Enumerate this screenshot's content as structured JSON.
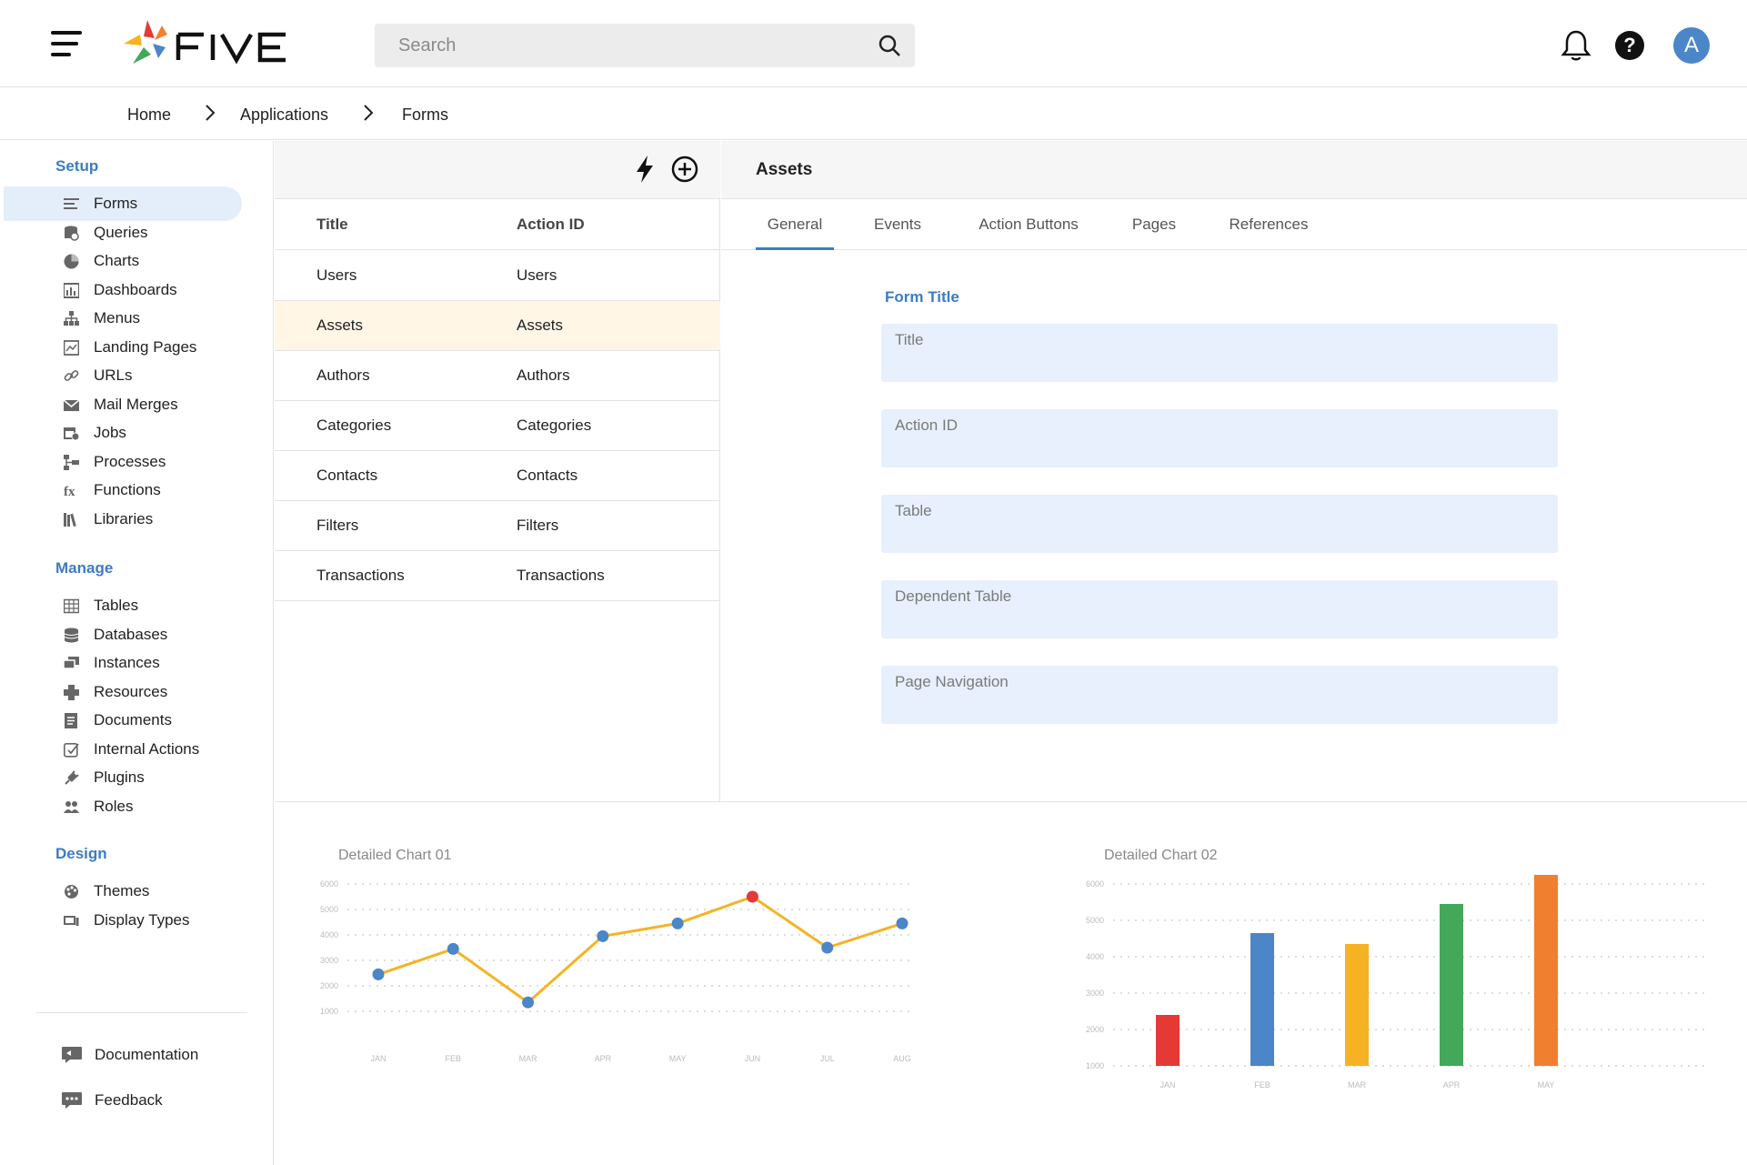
{
  "header": {
    "logo_text": "FIVE",
    "search_placeholder": "Search",
    "avatar_initial": "A",
    "help_label": "?"
  },
  "breadcrumb": [
    "Home",
    "Applications",
    "Forms"
  ],
  "sidebar": {
    "sections": [
      {
        "title": "Setup",
        "items": [
          {
            "label": "Forms",
            "icon": "forms-icon",
            "active": true
          },
          {
            "label": "Queries",
            "icon": "queries-icon"
          },
          {
            "label": "Charts",
            "icon": "charts-icon"
          },
          {
            "label": "Dashboards",
            "icon": "dashboards-icon"
          },
          {
            "label": "Menus",
            "icon": "menus-icon"
          },
          {
            "label": "Landing Pages",
            "icon": "landing-pages-icon"
          },
          {
            "label": "URLs",
            "icon": "link-icon"
          },
          {
            "label": "Mail Merges",
            "icon": "mail-icon"
          },
          {
            "label": "Jobs",
            "icon": "jobs-icon"
          },
          {
            "label": "Processes",
            "icon": "processes-icon"
          },
          {
            "label": "Functions",
            "icon": "functions-icon"
          },
          {
            "label": "Libraries",
            "icon": "libraries-icon"
          }
        ]
      },
      {
        "title": "Manage",
        "items": [
          {
            "label": "Tables",
            "icon": "tables-icon"
          },
          {
            "label": "Databases",
            "icon": "databases-icon"
          },
          {
            "label": "Instances",
            "icon": "instances-icon"
          },
          {
            "label": "Resources",
            "icon": "resources-icon"
          },
          {
            "label": "Documents",
            "icon": "documents-icon"
          },
          {
            "label": "Internal Actions",
            "icon": "internal-actions-icon"
          },
          {
            "label": "Plugins",
            "icon": "plugins-icon"
          },
          {
            "label": "Roles",
            "icon": "roles-icon"
          }
        ]
      },
      {
        "title": "Design",
        "items": [
          {
            "label": "Themes",
            "icon": "themes-icon"
          },
          {
            "label": "Display Types",
            "icon": "display-types-icon"
          }
        ]
      }
    ],
    "footer": [
      {
        "label": "Documentation",
        "icon": "documentation-icon"
      },
      {
        "label": "Feedback",
        "icon": "feedback-icon"
      }
    ]
  },
  "list": {
    "columns": [
      "Title",
      "Action ID"
    ],
    "rows": [
      [
        "Users",
        "Users"
      ],
      [
        "Assets",
        "Assets"
      ],
      [
        "Authors",
        "Authors"
      ],
      [
        "Categories",
        "Categories"
      ],
      [
        "Contacts",
        "Contacts"
      ],
      [
        "Filters",
        "Filters"
      ],
      [
        "Transactions",
        "Transactions"
      ]
    ],
    "selected_index": 1
  },
  "detail": {
    "title": "Assets",
    "tabs": [
      "General",
      "Events",
      "Action Buttons",
      "Pages",
      "References"
    ],
    "active_tab": 0,
    "form_title": "Form Title",
    "fields": [
      "Title",
      "Action ID",
      "Table",
      "Dependent Table",
      "Page Navigation"
    ]
  },
  "colors": {
    "accent": "#3c7cc4",
    "selected_row": "#fff6e6",
    "field_bg": "#e7f0fc",
    "line": "#f5b324",
    "point": "#4a86c8",
    "point_highlight": "#e53935"
  },
  "chart_data": [
    {
      "type": "line",
      "title": "Detailed Chart 01",
      "categories": [
        "JAN",
        "FEB",
        "MAR",
        "APR",
        "MAY",
        "JUN",
        "JUL",
        "AUG"
      ],
      "values": [
        2450,
        3450,
        1350,
        3950,
        4450,
        5500,
        3500,
        4450
      ],
      "highlight_index": 5,
      "yticks": [
        "6000",
        "5000",
        "4000",
        "3000",
        "2000",
        "1000"
      ],
      "ylim": [
        1000,
        6000
      ],
      "grid": true
    },
    {
      "type": "bar",
      "title": "Detailed Chart 02",
      "categories": [
        "JAN",
        "FEB",
        "MAR",
        "APR",
        "MAY"
      ],
      "values": [
        2400,
        4650,
        4350,
        5450,
        6300
      ],
      "colors": [
        "#e53935",
        "#4a86c8",
        "#f5b324",
        "#43a85a",
        "#f07f2f"
      ],
      "yticks": [
        "6000",
        "5000",
        "4000",
        "3000",
        "2000",
        "1000"
      ],
      "ylim": [
        1000,
        6000
      ],
      "grid": true
    }
  ]
}
